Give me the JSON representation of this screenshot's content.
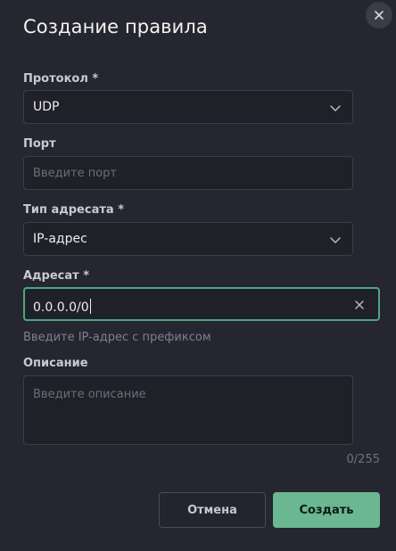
{
  "dialog": {
    "title": "Создание правила",
    "close_icon": "close-icon"
  },
  "form": {
    "protocol": {
      "label": "Протокол *",
      "value": "UDP",
      "icon": "chevron-down-icon"
    },
    "port": {
      "label": "Порт",
      "value": "",
      "placeholder": "Введите порт"
    },
    "destination_type": {
      "label": "Тип адресата *",
      "value": "IP-адрес",
      "icon": "chevron-down-icon"
    },
    "destination": {
      "label": "Адресат *",
      "value": "0.0.0.0/0",
      "hint": "Введите IP-адрес с префиксом",
      "clear_icon": "close-icon"
    },
    "description": {
      "label": "Описание",
      "value": "",
      "placeholder": "Введите описание",
      "counter": "0/255"
    }
  },
  "actions": {
    "cancel_label": "Отмена",
    "create_label": "Создать"
  },
  "colors": {
    "background": "#25262f",
    "field_background": "#1f2028",
    "accent": "#6ab791",
    "focus_border": "#4ea680"
  }
}
